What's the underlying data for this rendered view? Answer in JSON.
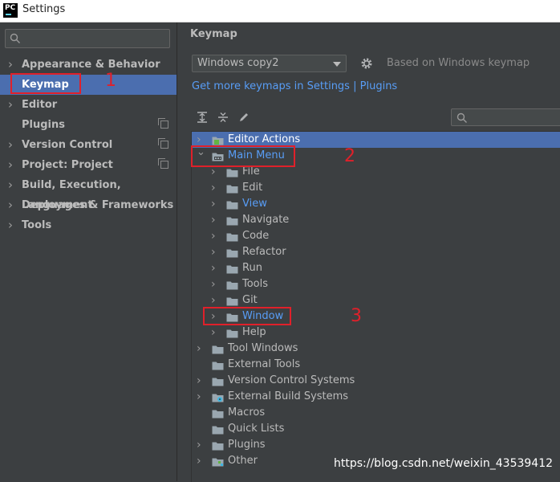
{
  "window": {
    "title": "Settings",
    "app_icon_text": "PC"
  },
  "sidebar": {
    "search_placeholder": "",
    "items": [
      {
        "label": "Appearance & Behavior",
        "chevron": true,
        "copy": false
      },
      {
        "label": "Keymap",
        "chevron": false,
        "copy": false,
        "selected": true
      },
      {
        "label": "Editor",
        "chevron": true,
        "copy": false
      },
      {
        "label": "Plugins",
        "chevron": false,
        "copy": true
      },
      {
        "label": "Version Control",
        "chevron": true,
        "copy": true
      },
      {
        "label": "Project: Project",
        "chevron": true,
        "copy": true
      },
      {
        "label": "Build, Execution, Deployment",
        "chevron": true,
        "copy": false
      },
      {
        "label": "Languages & Frameworks",
        "chevron": true,
        "copy": false
      },
      {
        "label": "Tools",
        "chevron": true,
        "copy": false
      }
    ]
  },
  "main": {
    "heading": "Keymap",
    "keymap_select": "Windows copy2",
    "based_on": "Based on Windows keymap",
    "link_settings": "Get more keymaps in Settings",
    "link_sep": "|",
    "link_plugins": "Plugins"
  },
  "tree": [
    {
      "label": "Editor Actions",
      "expanded": false,
      "icon": "editor-actions-icon",
      "blue": false,
      "selected": true
    },
    {
      "label": "Main Menu",
      "expanded": true,
      "icon": "menu-icon",
      "blue": true
    },
    {
      "label": "File",
      "expanded": false,
      "icon": "folder-icon",
      "blue": false
    },
    {
      "label": "Edit",
      "expanded": false,
      "icon": "folder-icon",
      "blue": false
    },
    {
      "label": "View",
      "expanded": false,
      "icon": "folder-icon",
      "blue": true
    },
    {
      "label": "Navigate",
      "expanded": false,
      "icon": "folder-icon",
      "blue": false
    },
    {
      "label": "Code",
      "expanded": false,
      "icon": "folder-icon",
      "blue": false
    },
    {
      "label": "Refactor",
      "expanded": false,
      "icon": "folder-icon",
      "blue": false
    },
    {
      "label": "Run",
      "expanded": false,
      "icon": "folder-icon",
      "blue": false
    },
    {
      "label": "Tools",
      "expanded": false,
      "icon": "folder-icon",
      "blue": false
    },
    {
      "label": "Git",
      "expanded": false,
      "icon": "folder-icon",
      "blue": false
    },
    {
      "label": "Window",
      "expanded": false,
      "icon": "folder-icon",
      "blue": true
    },
    {
      "label": "Help",
      "expanded": false,
      "icon": "folder-icon",
      "blue": false
    },
    {
      "label": "Tool Windows",
      "expanded": false,
      "icon": "folder-icon",
      "blue": false
    },
    {
      "label": "External Tools",
      "leaf": true,
      "icon": "folder-icon",
      "blue": false
    },
    {
      "label": "Version Control Systems",
      "expanded": false,
      "icon": "folder-icon",
      "blue": false
    },
    {
      "label": "External Build Systems",
      "expanded": false,
      "icon": "gear-folder-icon",
      "blue": false
    },
    {
      "label": "Macros",
      "leaf": true,
      "icon": "folder-icon",
      "blue": false
    },
    {
      "label": "Quick Lists",
      "leaf": true,
      "icon": "folder-icon",
      "blue": false
    },
    {
      "label": "Plugins",
      "expanded": false,
      "icon": "folder-icon",
      "blue": false
    },
    {
      "label": "Other",
      "expanded": false,
      "icon": "other-icon",
      "blue": false
    }
  ],
  "annotations": {
    "n1": "1",
    "n2": "2",
    "n3": "3"
  },
  "watermark": "https://blog.csdn.net/weixin_43539412",
  "colors": {
    "accent": "#4b6eaf",
    "link": "#589df6",
    "annotation": "#e0202a"
  }
}
